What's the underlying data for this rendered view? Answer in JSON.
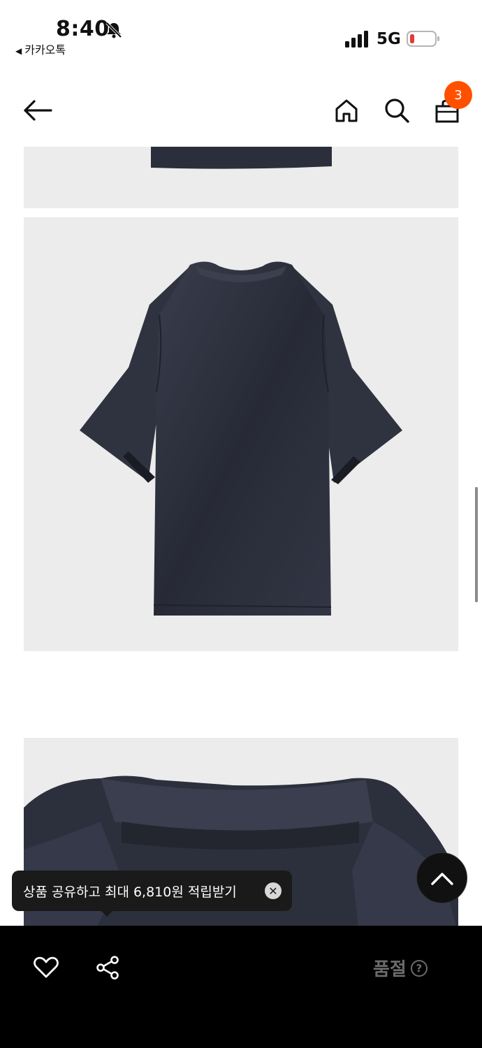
{
  "status_bar": {
    "time": "8:40",
    "back_app_label": "카카오톡",
    "network": "5G",
    "battery_color": "#e53935"
  },
  "header": {
    "cart_count": "3",
    "badge_color": "#ff5000",
    "icons": [
      "arrow-left-icon",
      "home-icon",
      "search-icon",
      "shopping-bag-icon"
    ]
  },
  "toast": {
    "text": "상품 공유하고 최대 6,810원 적립받기"
  },
  "bottom_bar": {
    "soldout_label": "품절",
    "help_symbol": "?"
  },
  "colors": {
    "garment": "#2b2e3b",
    "image_bg": "#ececec",
    "accent": "#ff5000"
  }
}
